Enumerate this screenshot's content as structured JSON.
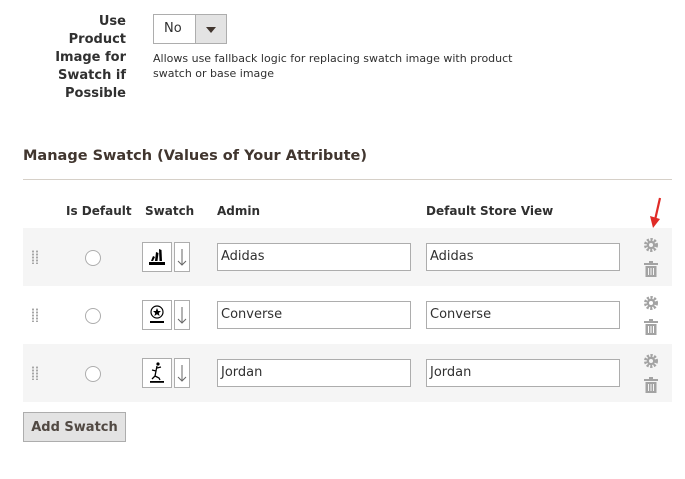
{
  "fallback": {
    "label": "Use Product Image for Swatch if Possible",
    "select_value": "No",
    "note": "Allows use fallback logic for replacing swatch image with product swatch or base image"
  },
  "manage_swatch": {
    "title": "Manage Swatch (Values of Your Attribute)",
    "headers": {
      "is_default": "Is Default",
      "swatch": "Swatch",
      "admin": "Admin",
      "store_view": "Default Store View"
    },
    "rows": [
      {
        "admin": "Adidas",
        "store": "Adidas",
        "swatch_icon": "adidas-logo-icon"
      },
      {
        "admin": "Converse",
        "store": "Converse",
        "swatch_icon": "converse-logo-icon"
      },
      {
        "admin": "Jordan",
        "store": "Jordan",
        "swatch_icon": "jordan-logo-icon"
      }
    ],
    "add_button": "Add Swatch"
  },
  "colors": {
    "annotation_arrow": "#e02b27",
    "alt_row": "#f5f5f5",
    "button": "#e3e3e3"
  }
}
